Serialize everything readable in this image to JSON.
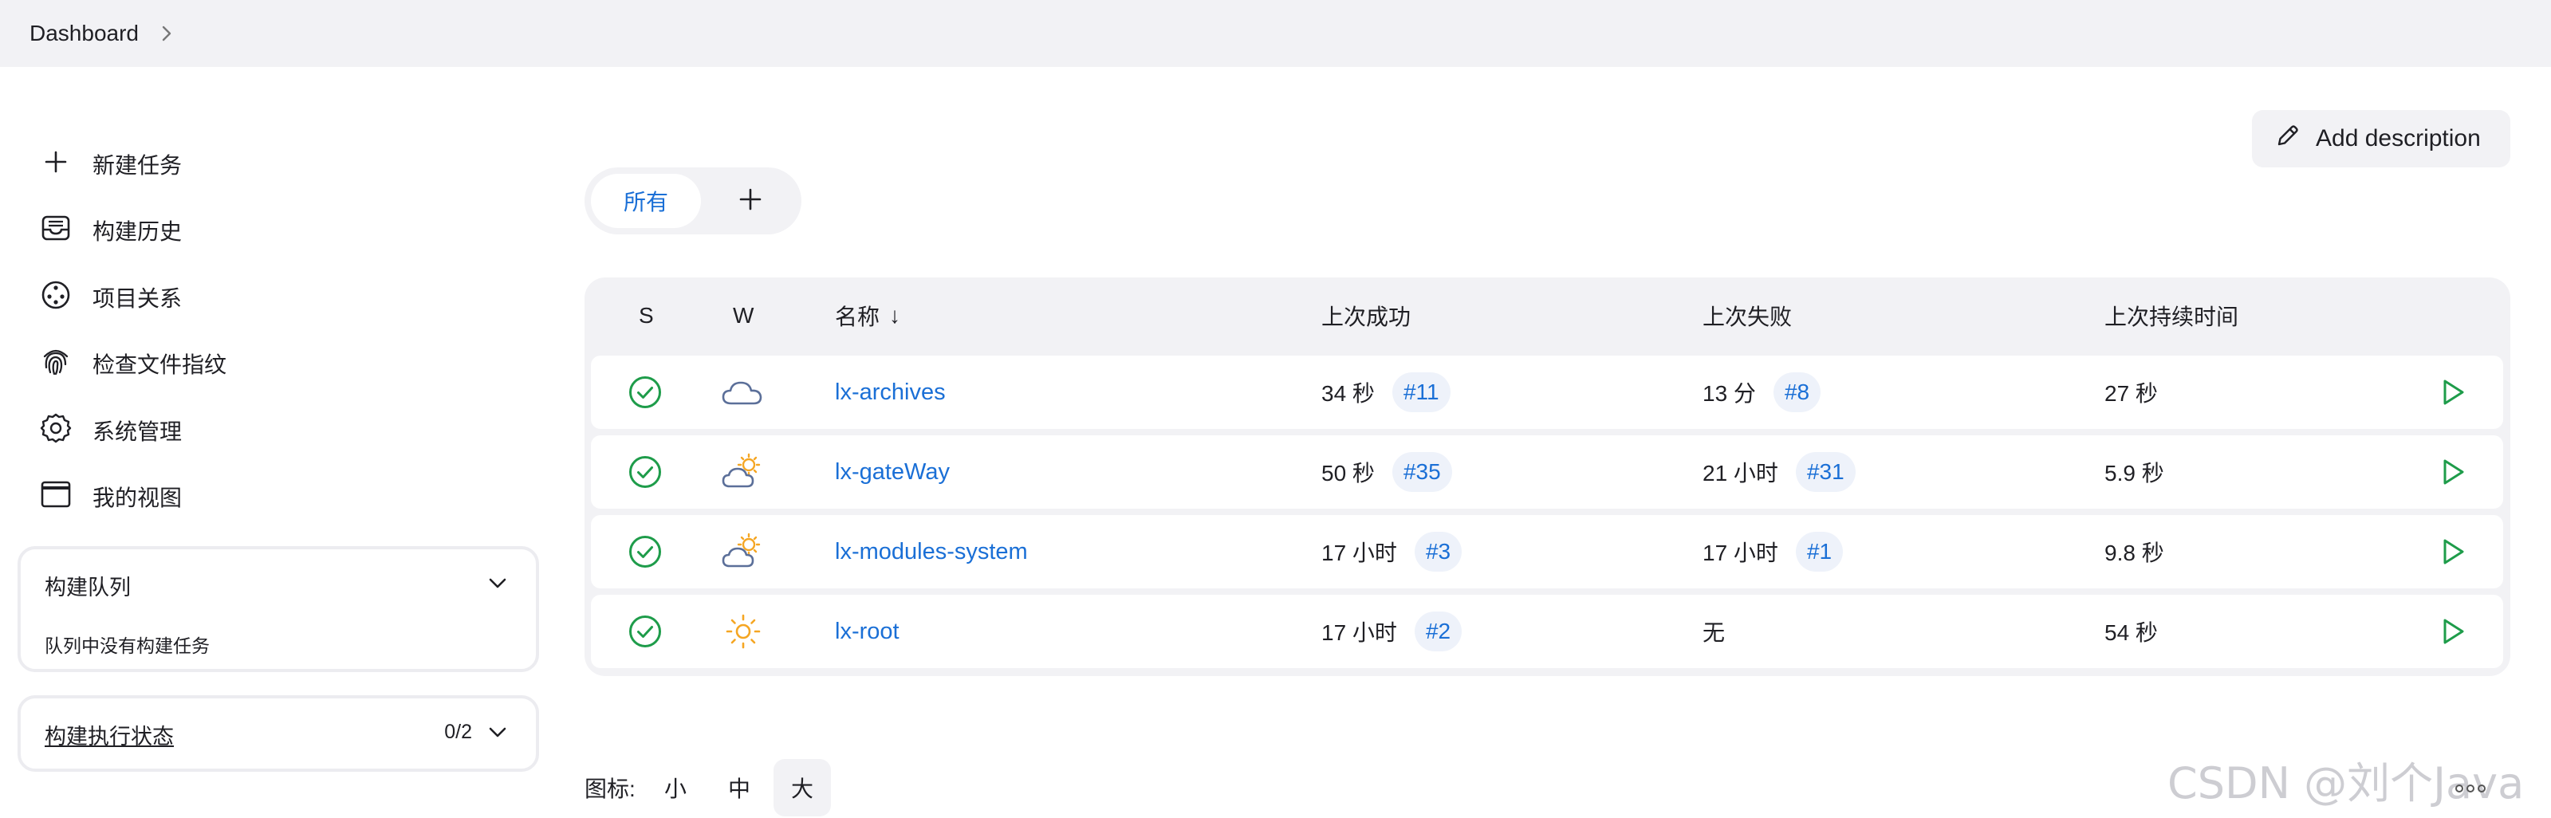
{
  "breadcrumb": {
    "root": "Dashboard"
  },
  "sidebar": {
    "items": [
      {
        "label": "新建任务",
        "icon": "plus-icon"
      },
      {
        "label": "构建历史",
        "icon": "inbox-icon"
      },
      {
        "label": "项目关系",
        "icon": "relationship-icon"
      },
      {
        "label": "检查文件指纹",
        "icon": "fingerprint-icon"
      },
      {
        "label": "系统管理",
        "icon": "gear-icon"
      },
      {
        "label": "我的视图",
        "icon": "window-icon"
      }
    ],
    "build_queue": {
      "title": "构建队列",
      "empty_text": "队列中没有构建任务"
    },
    "executor_status": {
      "title": "构建执行状态",
      "count": "0/2"
    }
  },
  "actions": {
    "add_description": "Add description"
  },
  "views": {
    "tabs": [
      {
        "label": "所有",
        "active": true
      }
    ],
    "add_icon": "plus-icon"
  },
  "table": {
    "headers": {
      "s": "S",
      "w": "W",
      "name": "名称",
      "sort_indicator": "↓",
      "last_success": "上次成功",
      "last_failure": "上次失败",
      "last_duration": "上次持续时间"
    },
    "rows": [
      {
        "status": "success",
        "weather": "cloudy",
        "name": "lx-archives",
        "last_success": "34 秒",
        "success_build": "#11",
        "last_failure": "13 分",
        "failure_build": "#8",
        "duration": "27 秒"
      },
      {
        "status": "success",
        "weather": "partly-sunny",
        "name": "lx-gateWay",
        "last_success": "50 秒",
        "success_build": "#35",
        "last_failure": "21 小时",
        "failure_build": "#31",
        "duration": "5.9 秒"
      },
      {
        "status": "success",
        "weather": "partly-sunny",
        "name": "lx-modules-system",
        "last_success": "17 小时",
        "success_build": "#3",
        "last_failure": "17 小时",
        "failure_build": "#1",
        "duration": "9.8 秒"
      },
      {
        "status": "success",
        "weather": "sunny",
        "name": "lx-root",
        "last_success": "17 小时",
        "success_build": "#2",
        "last_failure": "无",
        "failure_build": "",
        "duration": "54 秒"
      }
    ]
  },
  "icon_size": {
    "label": "图标:",
    "options": [
      "小",
      "中",
      "大"
    ],
    "selected": "大"
  },
  "watermark": "CSDN @刘个Java",
  "colors": {
    "accent": "#1a6fd6",
    "success": "#1e9c4a",
    "sun": "#f5a623",
    "cloud": "#5b6f99",
    "background_band": "#f2f2f5"
  }
}
